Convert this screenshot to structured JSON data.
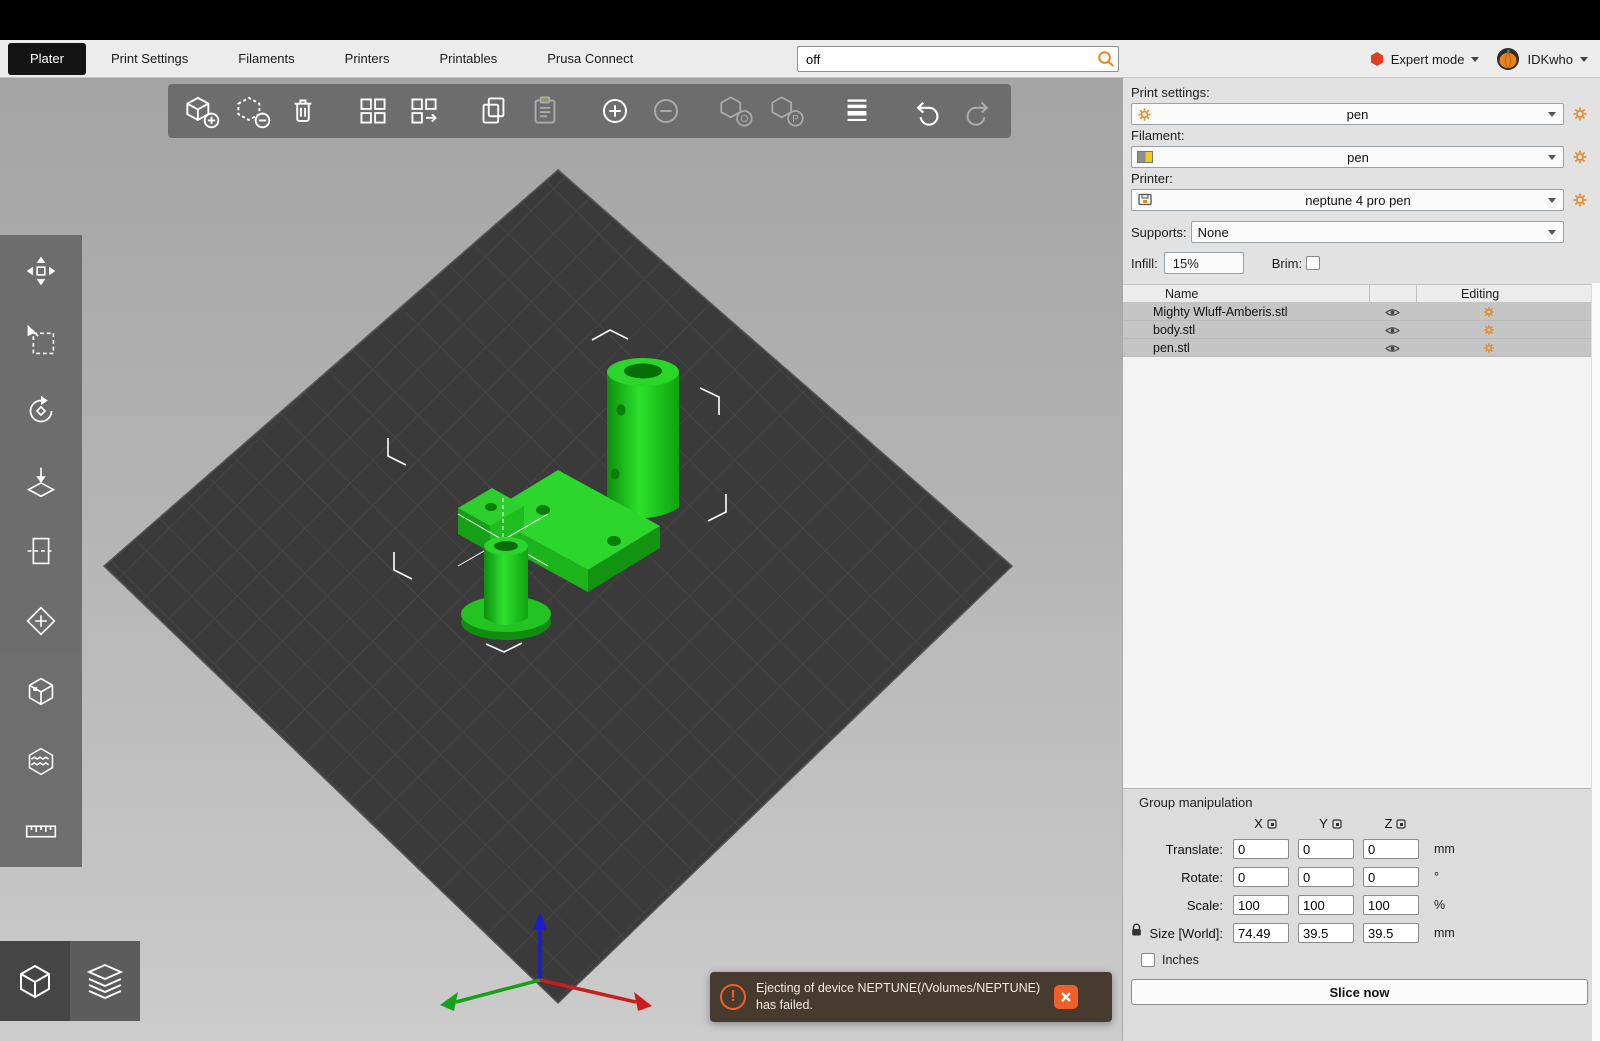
{
  "tabs": [
    {
      "label": "Plater"
    },
    {
      "label": "Print Settings"
    },
    {
      "label": "Filaments"
    },
    {
      "label": "Printers"
    },
    {
      "label": "Printables"
    },
    {
      "label": "Prusa Connect"
    }
  ],
  "search": {
    "value": "off"
  },
  "account": {
    "mode": "Expert mode",
    "user": "IDKwho"
  },
  "right_panel": {
    "print_settings": {
      "label": "Print settings:",
      "value": "pen"
    },
    "filament": {
      "label": "Filament:",
      "value": "pen"
    },
    "printer": {
      "label": "Printer:",
      "value": "neptune 4 pro pen"
    },
    "supports": {
      "label": "Supports:",
      "value": "None"
    },
    "infill": {
      "label": "Infill:",
      "value": "15%"
    },
    "brim": {
      "label": "Brim:"
    },
    "object_list": {
      "columns": {
        "name": "Name",
        "editing": "Editing"
      },
      "rows": [
        {
          "name": "Mighty Wluff-Amberis.stl"
        },
        {
          "name": "body.stl"
        },
        {
          "name": "pen.stl"
        }
      ]
    },
    "group_manipulation": {
      "title": "Group manipulation",
      "axes": [
        "X",
        "Y",
        "Z"
      ],
      "rows": [
        {
          "label": "Translate:",
          "x": "0",
          "y": "0",
          "z": "0",
          "unit": "mm"
        },
        {
          "label": "Rotate:",
          "x": "0",
          "y": "0",
          "z": "0",
          "unit": "°"
        },
        {
          "label": "Scale:",
          "x": "100",
          "y": "100",
          "z": "100",
          "unit": "%"
        },
        {
          "label": "Size [World]:",
          "x": "74.49",
          "y": "39.5",
          "z": "39.5",
          "unit": "mm"
        }
      ],
      "inches_label": "Inches",
      "slice_button": "Slice now"
    }
  },
  "notification": {
    "message": "Ejecting of device NEPTUNE(/Volumes/NEPTUNE) has failed."
  },
  "colors": {
    "accent_orange": "#e8861e",
    "alert_orange": "#f05f2a",
    "model_green": "#1ec81e",
    "bed_dark": "#3a3a3a"
  }
}
